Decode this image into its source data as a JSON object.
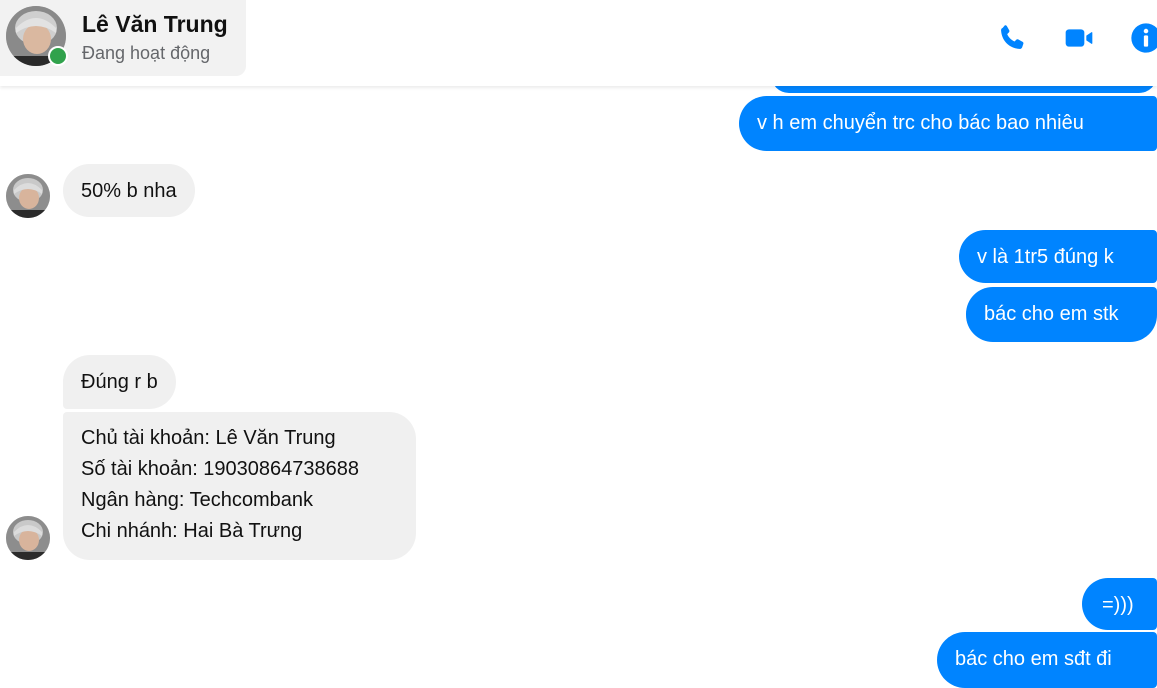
{
  "header": {
    "contact_name": "Lê Văn Trung",
    "contact_status": "Đang hoạt động",
    "icons": [
      "phone-icon",
      "video-camera-icon",
      "info-icon"
    ]
  },
  "colors": {
    "accent": "#0084ff",
    "incoming_bubble": "#f0f0f0",
    "online": "#31a24c"
  },
  "messages": [
    {
      "direction": "out",
      "text": "v h em chuyển trc cho bác bao nhiêu"
    },
    {
      "direction": "in",
      "text": "50% b nha"
    },
    {
      "direction": "out",
      "text": "v là 1tr5 đúng k"
    },
    {
      "direction": "out",
      "text": "bác cho em stk"
    },
    {
      "direction": "in",
      "text": "Đúng r b"
    },
    {
      "direction": "in",
      "text": "Chủ tài khoản: Lê Văn Trung\nSố tài khoản: 19030864738688\nNgân hàng: Techcombank\nChi nhánh: Hai Bà Trưng"
    },
    {
      "direction": "out",
      "text": "=)))"
    },
    {
      "direction": "out",
      "text": "bác cho em sđt đi"
    }
  ]
}
